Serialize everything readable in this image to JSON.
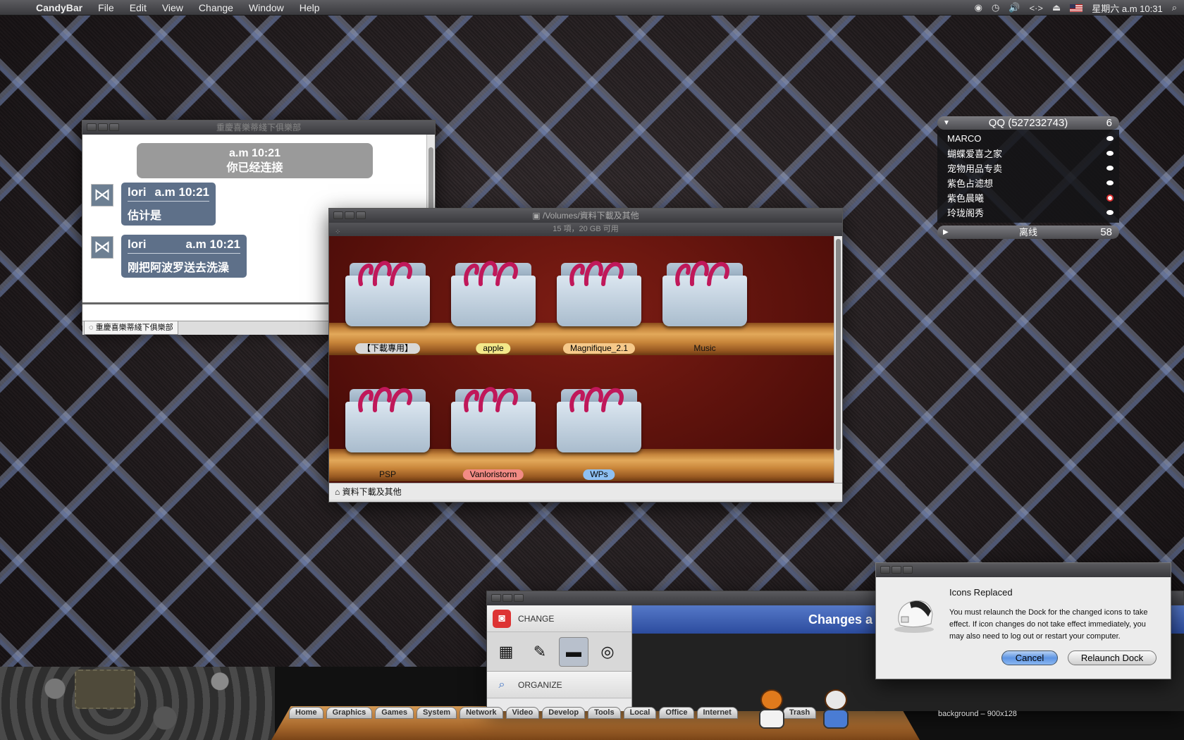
{
  "menubar": {
    "app_name": "CandyBar",
    "items": [
      "File",
      "Edit",
      "View",
      "Change",
      "Window",
      "Help"
    ],
    "clock": "星期六 a.m 10:31"
  },
  "chat": {
    "title": "重慶喜樂蒂綫下俱樂部",
    "system_time": "a.m 10:21",
    "system_text": "你已经连接",
    "messages": [
      {
        "sender": "lori",
        "time": "a.m 10:21",
        "text": "估计是"
      },
      {
        "sender": "lori",
        "time": "a.m 10:21",
        "text": "刚把阿波罗送去洗澡"
      }
    ],
    "tab_label": "重慶喜樂蒂綫下俱樂部"
  },
  "finder": {
    "title": "/Volumes/資料下載及其他",
    "status": "15 項，20 GB 可用",
    "path_label": "資料下載及其他",
    "folders": [
      {
        "name": "【下載專用】",
        "label_color": "#d8d8d8"
      },
      {
        "name": "apple",
        "label_color": "#f3e88a"
      },
      {
        "name": "Magnifique_2.1",
        "label_color": "#f6c98a"
      },
      {
        "name": "Music",
        "label_color": ""
      },
      {
        "name": "PSP",
        "label_color": ""
      },
      {
        "name": "Vanloristorm",
        "label_color": "#f28b84"
      },
      {
        "name": "WPs",
        "label_color": "#8ec0f2"
      }
    ]
  },
  "qq": {
    "header": "QQ (527232743)",
    "online_count": "6",
    "contacts": [
      {
        "name": "MARCO",
        "status": "online"
      },
      {
        "name": "蝴蝶爱喜之家",
        "status": "online"
      },
      {
        "name": "宠物用品专卖",
        "status": "online"
      },
      {
        "name": "紫色占滤想",
        "status": "online"
      },
      {
        "name": "紫色晨曦",
        "status": "busy"
      },
      {
        "name": "玲珑阁秀",
        "status": "online"
      }
    ],
    "offline_label": "离线",
    "offline_count": "58"
  },
  "dock": {
    "tabs": [
      "Home",
      "Graphics",
      "Games",
      "System",
      "Network",
      "Video",
      "Develop",
      "Tools",
      "Local",
      "Office",
      "Internet",
      "Trash"
    ],
    "background_label": "background – 900x128"
  },
  "candybar": {
    "side_change": "CHANGE",
    "side_organize": "ORGANIZE",
    "banner_text": "Changes a"
  },
  "alert": {
    "title": "Icons Replaced",
    "message": "You must relaunch the Dock for the changed icons to take effect.  If icon changes do not take effect immediately, you may also need to log out or restart your computer.",
    "cancel": "Cancel",
    "relaunch": "Relaunch Dock"
  },
  "colors": {
    "shelf_wood": "#c7873e",
    "shelf_back": "#7e1d14",
    "chat_bubble": "#5e7089",
    "banner_blue": "#3a5fb5"
  }
}
